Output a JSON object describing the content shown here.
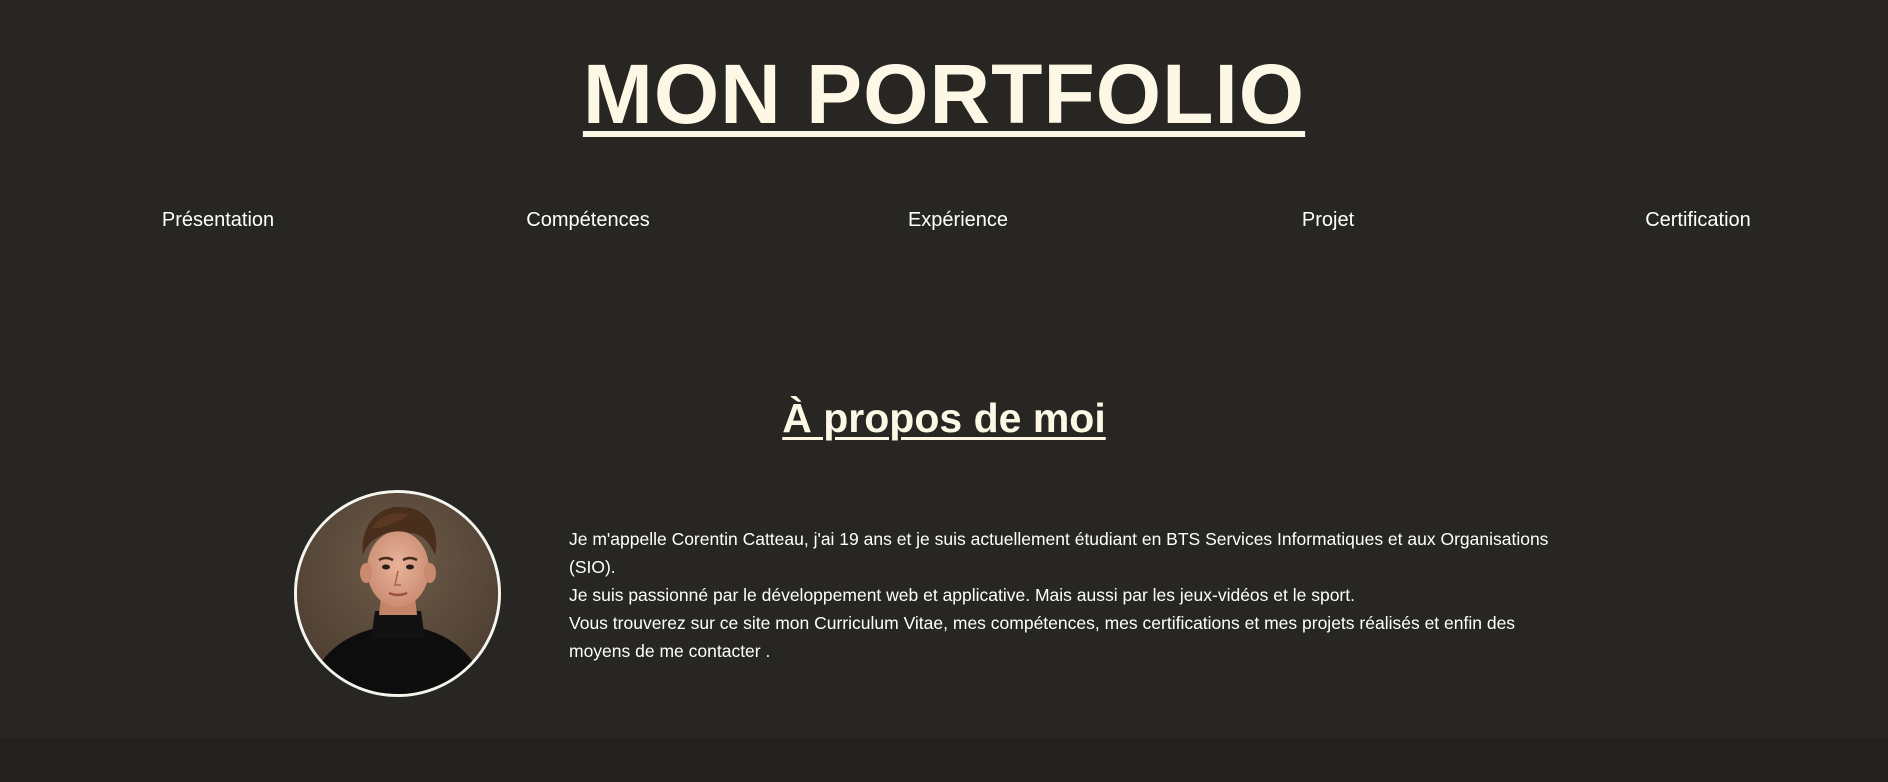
{
  "header": {
    "title": "MON PORTFOLIO"
  },
  "nav": {
    "items": [
      {
        "label": "Présentation"
      },
      {
        "label": "Compétences"
      },
      {
        "label": "Expérience"
      },
      {
        "label": "Projet"
      },
      {
        "label": "Certification"
      }
    ]
  },
  "about": {
    "title": "À propos de moi",
    "paragraphs": [
      "Je m'appelle Corentin Catteau, j'ai 19 ans et je suis actuellement étudiant en BTS Services Informatiques et aux Organisations (SIO).",
      "Je suis passionné par le développement web et applicative. Mais aussi par les jeux-vidéos et le sport.",
      "Vous trouverez sur ce site mon Curriculum Vitae, mes compétences, mes certifications et mes projets réalisés et enfin des moyens de me contacter ."
    ],
    "photo_icon": "profile-photo"
  },
  "colors": {
    "background": "#272622",
    "title": "#fdf8e6",
    "text": "#ffffff",
    "avatar_border": "#f5f5f0"
  }
}
